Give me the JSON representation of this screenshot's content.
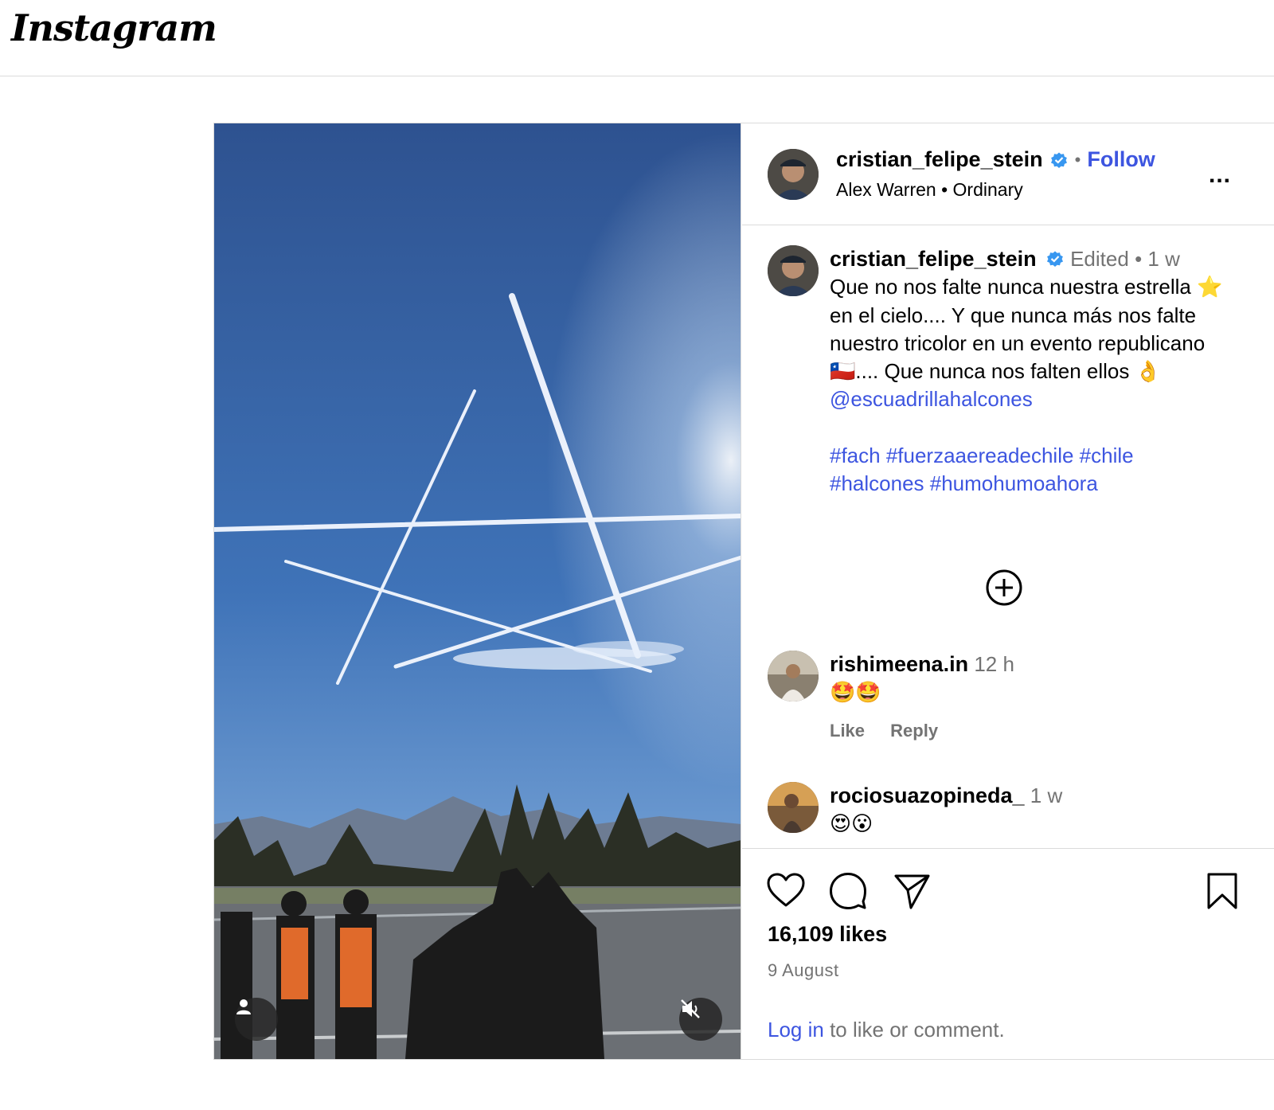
{
  "app": {
    "logo_text": "Instagram"
  },
  "post": {
    "author": {
      "username": "cristian_felipe_stein",
      "verified": true,
      "follow_label": "Follow"
    },
    "audio": {
      "artist": "Alex Warren",
      "track": "Ordinary"
    },
    "more_label": "...",
    "caption": {
      "username": "cristian_felipe_stein",
      "edited_label": "Edited",
      "age": "1 w",
      "text_1": "Que no nos falte nunca nuestra estrella",
      "emoji_star": "⭐",
      "text_2": " en el cielo.... Y que nunca más nos falte nuestro tricolor en un evento republicano ",
      "emoji_flag": "🇨🇱",
      "text_3": ".... Que nunca nos falten ellos ",
      "emoji_ok": "👌",
      "mention": "@escuadrillahalcones",
      "hashtags_line1": "#fach #fuerzaaereadechile #chile",
      "hashtags_line2": "#halcones #humohumoahora"
    },
    "comments": [
      {
        "username": "rishimeena.in",
        "age": "12 h",
        "text": "🤩🤩",
        "like_label": "Like",
        "reply_label": "Reply"
      },
      {
        "username": "rociosuazopineda_",
        "age": "1 w",
        "text": "😍😮"
      }
    ],
    "likes": "16,109 likes",
    "date": "9 August",
    "login_link": "Log in",
    "login_rest": " to like or comment."
  },
  "colors": {
    "link": "#3d55e0",
    "verified": "#3897f0",
    "muted": "#737373",
    "sky": "#2f5a9c"
  },
  "icons": [
    "verified-badge-icon",
    "more-options-icon",
    "load-more-comments-icon",
    "heart-icon",
    "comment-icon",
    "share-icon",
    "bookmark-icon",
    "user-tag-icon",
    "muted-audio-icon"
  ]
}
